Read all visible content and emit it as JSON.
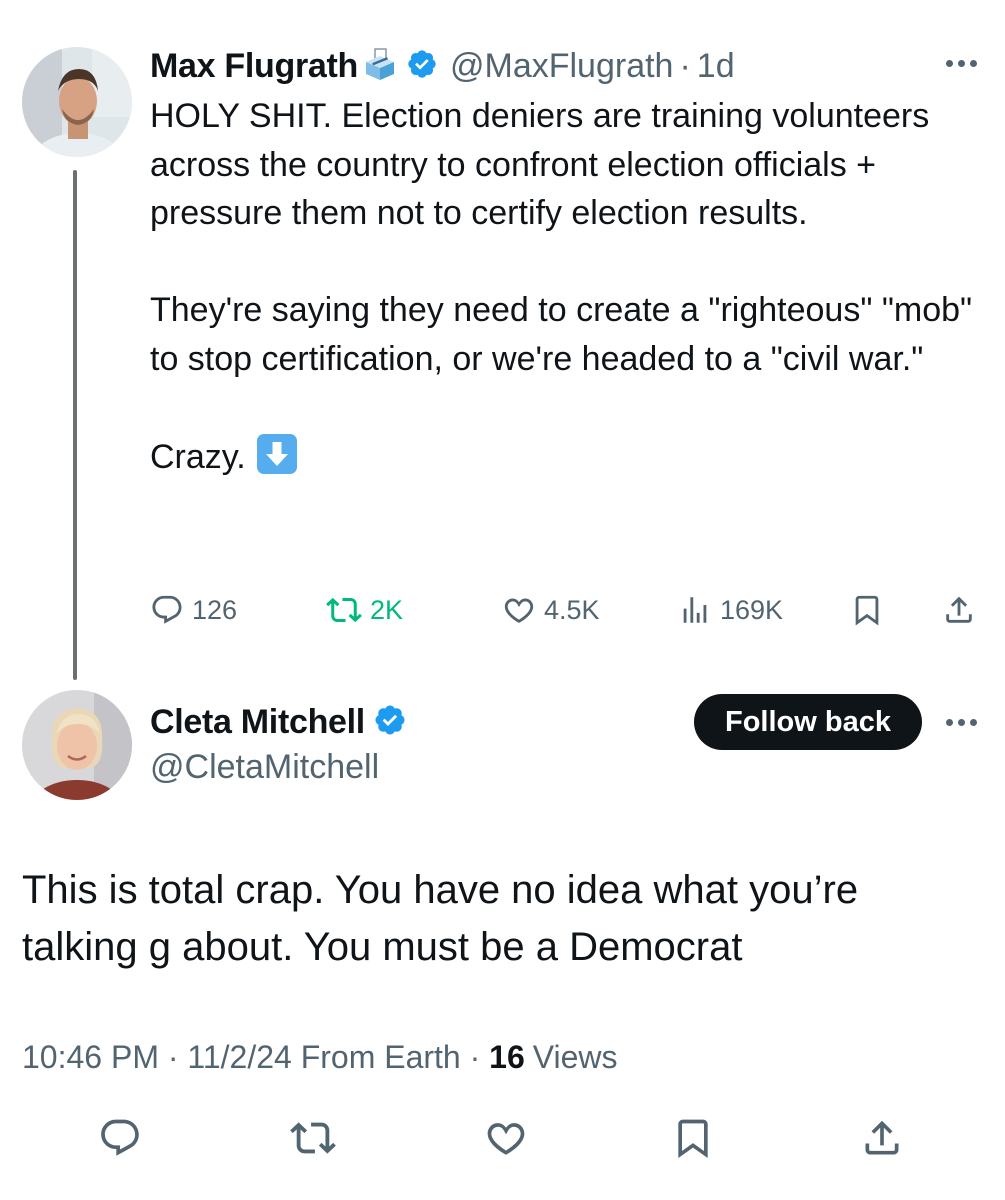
{
  "quoted_tweet": {
    "author_name": "Max Flugrath",
    "handle": "@MaxFlugrath",
    "separator": "·",
    "time": "1d",
    "text": "HOLY SHIT. Election deniers are training volunteers across the country to confront election officials + pressure them not to certify election results.\n\nThey're saying they need to create a \"righteous\" \"mob\" to stop certification, or we're headed to a \"civil war.\"\n\nCrazy. ",
    "down_emoji": "⬇️",
    "name_emoji": "ballot-box-icon",
    "metrics": {
      "replies": "126",
      "reposts": "2K",
      "likes": "4.5K",
      "views": "169K"
    }
  },
  "reply": {
    "author_name": "Cleta Mitchell",
    "handle": "@CletaMitchell",
    "follow_label": "Follow back",
    "text": "This is total crap. You have no idea what you’re talking g about. You must be a Democrat",
    "timestamp": "10:46 PM · 11/2/24 From Earth · ",
    "views_count": "16",
    "views_label": "Views"
  },
  "colors": {
    "text": "#0f1419",
    "secondary": "#536471",
    "verified": "#1d9bf0",
    "repost_active": "#00ba7c",
    "thread_line": "#6b6f74"
  }
}
